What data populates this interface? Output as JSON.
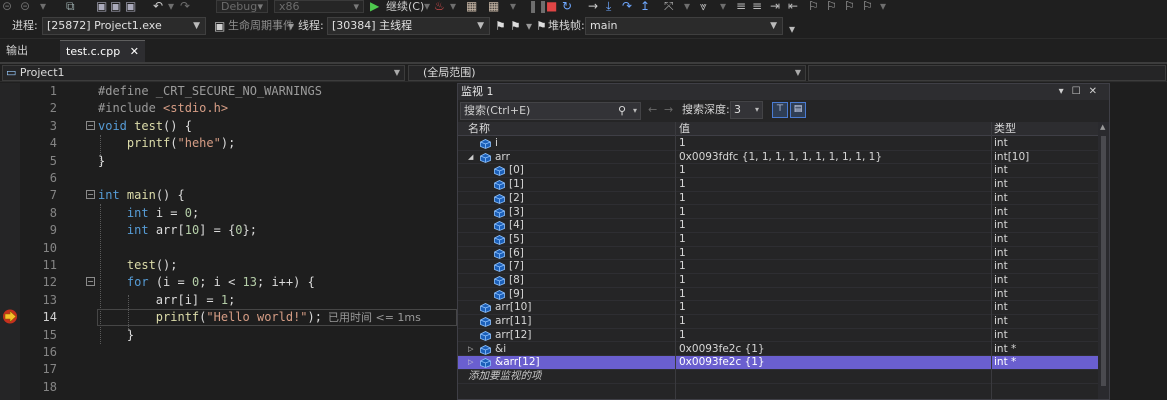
{
  "toolbar": {
    "config": "Debug",
    "platform": "x86",
    "continue_label": "继续(C)",
    "process_label": "进程:",
    "process_value": "[25872] Project1.exe",
    "lifecycle_label": "生命周期事件",
    "thread_label": "线程:",
    "thread_value": "[30384] 主线程",
    "stackframe_label": "堆栈帧:",
    "stackframe_value": "main"
  },
  "tabs": [
    {
      "label": "输出"
    },
    {
      "label": "test.c.cpp",
      "close": "✕"
    }
  ],
  "navbar": {
    "project": "Project1",
    "scope": "(全局范围)"
  },
  "editor": {
    "line_numbers": [
      "1",
      "2",
      "3",
      "4",
      "5",
      "6",
      "7",
      "8",
      "9",
      "10",
      "11",
      "12",
      "13",
      "14",
      "15",
      "16",
      "17",
      "18"
    ],
    "current_line": 14,
    "perf_tip": "已用时间 <= 1ms"
  },
  "watch": {
    "title": "监视 1",
    "search_placeholder": "搜索(Ctrl+E)",
    "depth_label": "搜索深度:",
    "depth_value": "3",
    "columns": {
      "name": "名称",
      "value": "值",
      "type": "类型"
    },
    "rows": [
      {
        "name": "i",
        "value": "1",
        "type": "int",
        "indent": 0,
        "expander": ""
      },
      {
        "name": "arr",
        "value": "0x0093fdfc {1, 1, 1, 1, 1, 1, 1, 1, 1, 1}",
        "type": "int[10]",
        "indent": 0,
        "expander": "◢"
      },
      {
        "name": "[0]",
        "value": "1",
        "type": "int",
        "indent": 1,
        "expander": ""
      },
      {
        "name": "[1]",
        "value": "1",
        "type": "int",
        "indent": 1,
        "expander": ""
      },
      {
        "name": "[2]",
        "value": "1",
        "type": "int",
        "indent": 1,
        "expander": ""
      },
      {
        "name": "[3]",
        "value": "1",
        "type": "int",
        "indent": 1,
        "expander": ""
      },
      {
        "name": "[4]",
        "value": "1",
        "type": "int",
        "indent": 1,
        "expander": ""
      },
      {
        "name": "[5]",
        "value": "1",
        "type": "int",
        "indent": 1,
        "expander": ""
      },
      {
        "name": "[6]",
        "value": "1",
        "type": "int",
        "indent": 1,
        "expander": ""
      },
      {
        "name": "[7]",
        "value": "1",
        "type": "int",
        "indent": 1,
        "expander": ""
      },
      {
        "name": "[8]",
        "value": "1",
        "type": "int",
        "indent": 1,
        "expander": ""
      },
      {
        "name": "[9]",
        "value": "1",
        "type": "int",
        "indent": 1,
        "expander": ""
      },
      {
        "name": "arr[10]",
        "value": "1",
        "type": "int",
        "indent": 0,
        "expander": ""
      },
      {
        "name": "arr[11]",
        "value": "1",
        "type": "int",
        "indent": 0,
        "expander": ""
      },
      {
        "name": "arr[12]",
        "value": "1",
        "type": "int",
        "indent": 0,
        "expander": ""
      },
      {
        "name": "&i",
        "value": "0x0093fe2c {1}",
        "type": "int *",
        "indent": 0,
        "expander": "▷"
      },
      {
        "name": "&arr[12]",
        "value": "0x0093fe2c {1}",
        "type": "int *",
        "indent": 0,
        "expander": "▷",
        "selected": true
      }
    ],
    "add_item": "添加要监视的项"
  },
  "colors": {
    "keyword": "#569cd6",
    "string": "#d69d85",
    "number": "#b5cea8",
    "selection": "#6a5fcf",
    "arrow": "#f0a020"
  }
}
